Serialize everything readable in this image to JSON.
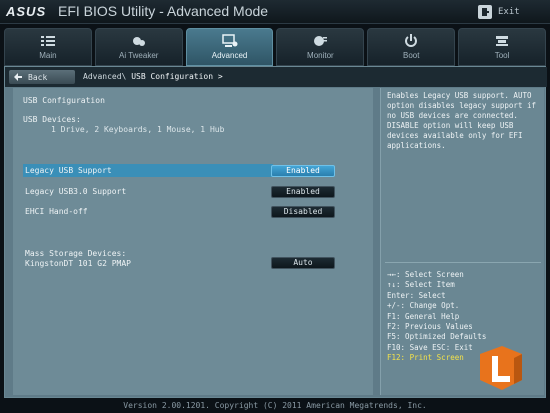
{
  "header": {
    "brand": "ASUS",
    "title": "EFI BIOS Utility - Advanced Mode",
    "exit_label": "Exit"
  },
  "tabs": [
    {
      "label": "Main",
      "icon": "list-icon"
    },
    {
      "label": "Ai Tweaker",
      "icon": "tweaker-icon"
    },
    {
      "label": "Advanced",
      "icon": "advanced-icon",
      "active": true
    },
    {
      "label": "Monitor",
      "icon": "monitor-icon"
    },
    {
      "label": "Boot",
      "icon": "power-icon"
    },
    {
      "label": "Tool",
      "icon": "tool-icon"
    }
  ],
  "nav": {
    "back_label": "Back",
    "breadcrumb_parent": "Advanced\\",
    "breadcrumb_current": "USB Configuration >"
  },
  "main": {
    "section_title": "USB Configuration",
    "devices_label": "USB Devices:",
    "devices_value": "1 Drive, 2 Keyboards, 1 Mouse, 1 Hub",
    "settings": [
      {
        "label": "Legacy USB Support",
        "value": "Enabled"
      },
      {
        "label": "Legacy USB3.0 Support",
        "value": "Enabled"
      },
      {
        "label": "EHCI Hand-off",
        "value": "Disabled"
      }
    ],
    "mass_storage_label": "Mass Storage Devices:",
    "mass_storage_device": "KingstonDT 101 G2 PMAP",
    "mass_storage_value": "Auto"
  },
  "help": {
    "text": "Enables Legacy USB support. AUTO option disables legacy support if no USB devices are connected. DISABLE option will keep USB devices available only for EFI applications."
  },
  "keys": [
    "→←: Select Screen",
    "↑↓: Select Item",
    "Enter: Select",
    "+/-: Change Opt.",
    "F1: General Help",
    "F2: Previous Values",
    "F5: Optimized Defaults",
    "F10: Save  ESC: Exit",
    "F12: Print Screen"
  ],
  "footer": "Version 2.00.1201. Copyright (C) 2011 American Megatrends, Inc.",
  "colors": {
    "accent": "#3a8fb8",
    "panel": "#6e8b97",
    "highlight_key": "#f3e24a",
    "logo_orange": "#e8731c"
  }
}
